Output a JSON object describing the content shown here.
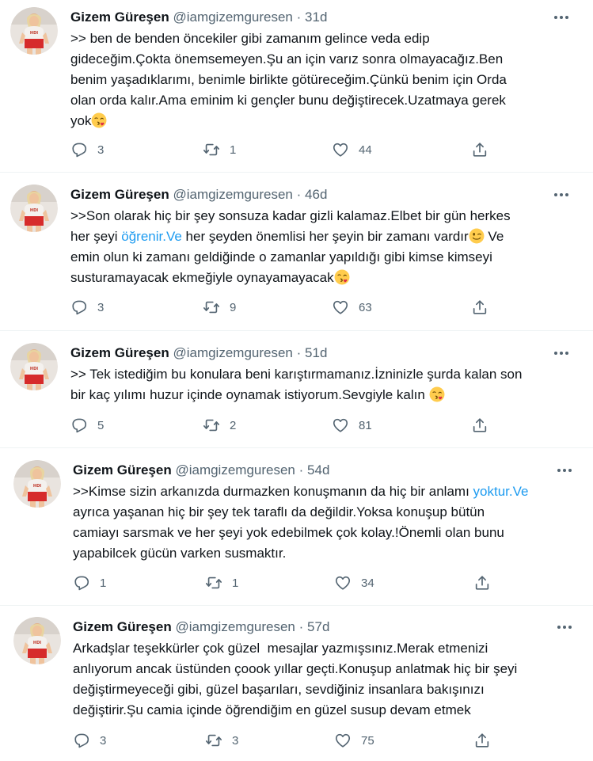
{
  "tweets": [
    {
      "name": "Gizem Güreşen",
      "handle": "@iamgizemguresen",
      "separator": "·",
      "time": "31d",
      "segments": [
        {
          "text": ">> ben de benden öncekiler gibi zamanım gelince veda edip\ngideceğim.Çokta önemsemeyen.Şu an için varız sonra olmayacağız.Ben\nbenim yaşadıklarımı, benimle birlikte götüreceğim.Çünkü benim için Orda\nolan orda kalır.Ama eminim ki gençler bunu değiştirecek.Uzatmaya gerek\nyok",
          "type": "text"
        },
        {
          "emoji": "kissing-face-heart-emoji",
          "type": "emoji"
        }
      ],
      "replies": "3",
      "retweets": "1",
      "likes": "44",
      "reply_icon": "reply-icon",
      "retweet_icon": "retweet-icon",
      "like_icon": "heart-icon",
      "share_icon": "share-icon"
    },
    {
      "name": "Gizem Güreşen",
      "handle": "@iamgizemguresen",
      "separator": "·",
      "time": "46d",
      "segments": [
        {
          "text": ">>Son olarak hiç bir şey sonsuza kadar gizli kalamaz.Elbet bir gün herkes\nher şeyi ",
          "type": "text"
        },
        {
          "text": "öğrenir.Ve",
          "type": "link"
        },
        {
          "text": " her şeyden önemlisi her şeyin bir zamanı vardır",
          "type": "text"
        },
        {
          "emoji": "winking-face-emoji",
          "type": "emoji"
        },
        {
          "text": " Ve\nemin olun ki zamanı geldiğinde o zamanlar yapıldığı gibi kimse kimseyi\nsusturamayacak ekmeğiyle oynayamayacak",
          "type": "text"
        },
        {
          "emoji": "kissing-face-heart-emoji",
          "type": "emoji"
        }
      ],
      "replies": "3",
      "retweets": "9",
      "likes": "63",
      "reply_icon": "reply-icon",
      "retweet_icon": "retweet-icon",
      "like_icon": "heart-icon",
      "share_icon": "share-icon"
    },
    {
      "name": "Gizem Güreşen",
      "handle": "@iamgizemguresen",
      "separator": "·",
      "time": "51d",
      "segments": [
        {
          "text": ">> Tek istediğim bu konulara beni karıştırmamanız.İzninizle şurda kalan son\nbir kaç yılımı huzur içinde oynamak istiyorum.Sevgiyle kalın ",
          "type": "text"
        },
        {
          "emoji": "kissing-face-heart-emoji",
          "type": "emoji"
        }
      ],
      "replies": "5",
      "retweets": "2",
      "likes": "81",
      "reply_icon": "reply-icon",
      "retweet_icon": "retweet-icon",
      "like_icon": "heart-icon",
      "share_icon": "share-icon"
    },
    {
      "name": "Gizem Güreşen",
      "handle": "@iamgizemguresen",
      "separator": "·",
      "time": "54d",
      "segments": [
        {
          "text": ">>Kimse sizin arkanızda durmazken konuşmanın da hiç bir anlamı ",
          "type": "text"
        },
        {
          "text": "yoktur.Ve",
          "type": "link"
        },
        {
          "text": "\nayrıca yaşanan hiç bir şey tek taraflı da değildir.Yoksa konuşup bütün\ncamiayı sarsmak ve her şeyi yok edebilmek çok kolay.!Önemli olan bunu\nyapabilcek gücün varken susmaktır.",
          "type": "text"
        }
      ],
      "replies": "1",
      "retweets": "1",
      "likes": "34",
      "reply_icon": "reply-icon",
      "retweet_icon": "retweet-icon",
      "like_icon": "heart-icon",
      "share_icon": "share-icon"
    },
    {
      "name": "Gizem Güreşen",
      "handle": "@iamgizemguresen",
      "separator": "·",
      "time": "57d",
      "segments": [
        {
          "text": "Arkadşlar teşekkürler çok güzel  mesajlar yazmışsınız.Merak etmenizi\nanlıyorum ancak üstünden çoook yıllar geçti.Konuşup anlatmak hiç bir şeyi\ndeğiştirmeyeceği gibi, güzel başarıları, sevdiğiniz insanlara bakışınızı\ndeğiştirir.Şu camia içinde öğrendiğim en güzel susup devam etmek",
          "type": "text"
        }
      ],
      "replies": "3",
      "retweets": "3",
      "likes": "75",
      "reply_icon": "reply-icon",
      "retweet_icon": "retweet-icon",
      "like_icon": "heart-icon",
      "share_icon": "share-icon"
    }
  ],
  "colors": {
    "text": "#0f1419",
    "muted": "#536471",
    "link": "#1d9bf0",
    "border": "#eff3f4"
  }
}
